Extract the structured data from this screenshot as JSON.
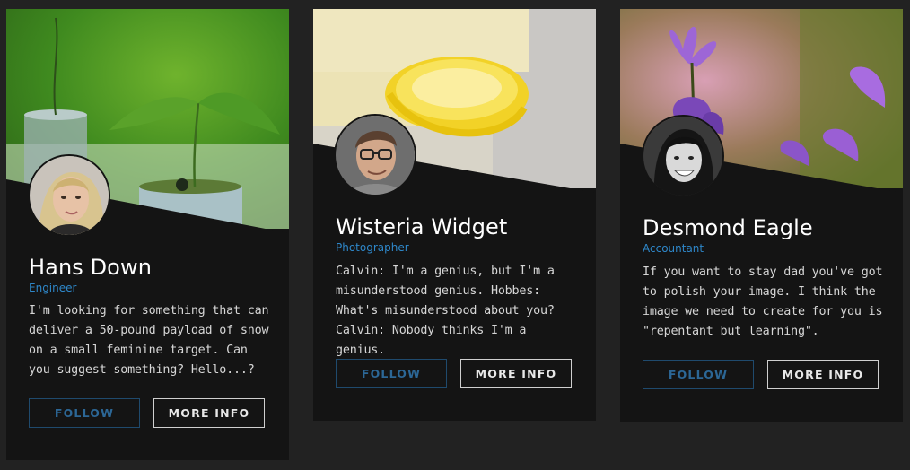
{
  "cards": [
    {
      "name": "Hans Down",
      "role": "Engineer",
      "bio": "I'm looking for something that can deliver a 50-pound payload of snow on a small feminine target. Can you suggest something? Hello...?",
      "follow_label": "FOLLOW",
      "more_label": "MORE INFO"
    },
    {
      "name": "Wisteria Widget",
      "role": "Photographer",
      "bio": "Calvin: I'm a genius, but I'm a misunderstood genius. Hobbes: What's misunderstood about you? Calvin: Nobody thinks I'm a genius.",
      "follow_label": "FOLLOW",
      "more_label": "MORE INFO"
    },
    {
      "name": "Desmond Eagle",
      "role": "Accountant",
      "bio": "If you want to stay dad you've got to polish your image. I think the image we need to create for you is \"repentant but learning\".",
      "follow_label": "FOLLOW",
      "more_label": "MORE INFO"
    }
  ],
  "colors": {
    "page_bg": "#222222",
    "card_bg": "#141414",
    "role_text": "#2e87c9",
    "follow_border": "#1f4a6d"
  }
}
